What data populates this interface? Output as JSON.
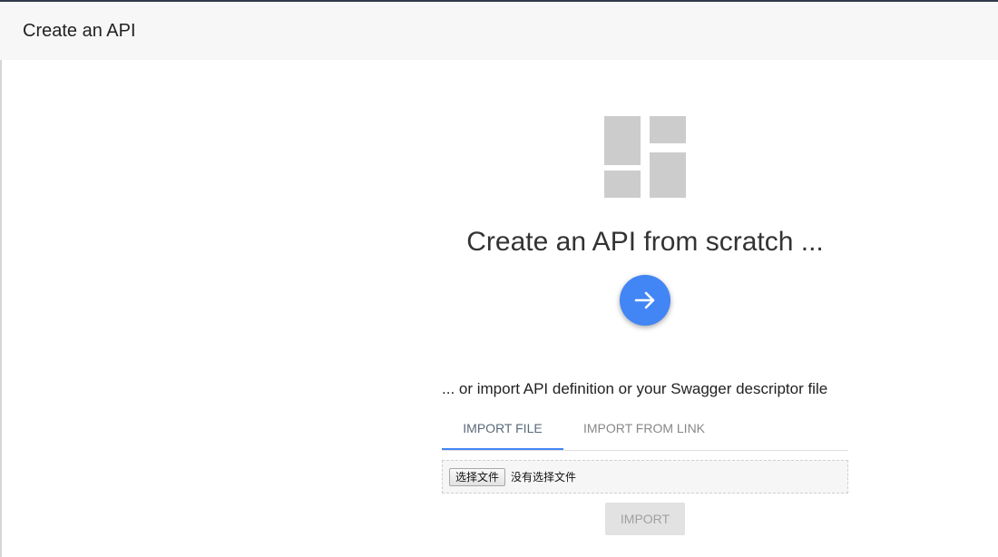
{
  "header": {
    "title": "Create an API"
  },
  "hero": {
    "icon": "api-blocks-icon",
    "title": "Create an API from scratch ...",
    "action_icon": "arrow-right-icon",
    "accent_color": "#4285f4"
  },
  "import": {
    "heading": "... or import API definition or your Swagger descriptor file",
    "tabs": [
      {
        "label": "IMPORT FILE",
        "active": true
      },
      {
        "label": "IMPORT FROM LINK",
        "active": false
      }
    ],
    "file_button_label": "选择文件",
    "file_status": "没有选择文件",
    "import_button_label": "IMPORT"
  }
}
